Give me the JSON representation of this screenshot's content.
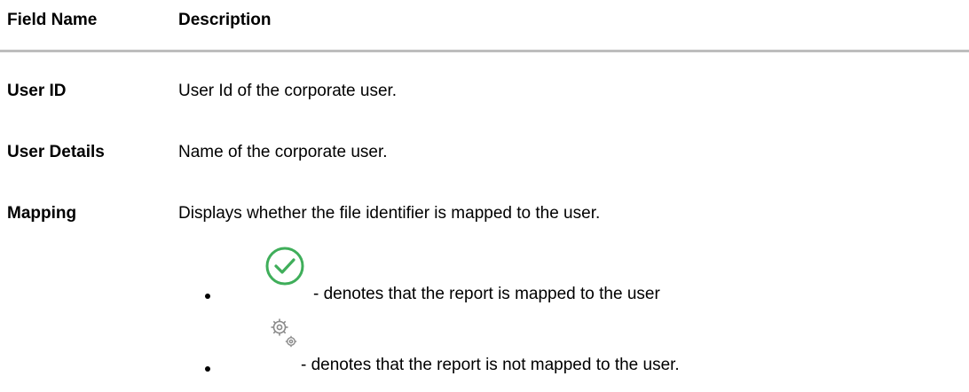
{
  "table": {
    "headers": {
      "field_name": "Field Name",
      "description": "Description"
    },
    "rows": [
      {
        "field": "User ID",
        "description": "User Id of the corporate user."
      },
      {
        "field": "User Details",
        "description": "Name of the corporate user."
      },
      {
        "field": "Mapping",
        "description": "Displays whether the file identifier is mapped to the user."
      }
    ],
    "mapping_bullets": [
      {
        "icon": "check-circle-icon",
        "text": "- denotes that the report is mapped to the user"
      },
      {
        "icon": "gears-icon",
        "text": "- denotes that the report is not mapped to the user."
      }
    ]
  },
  "colors": {
    "header_rule": "#bdbdbd",
    "check_green": "#3fae5a",
    "gear_gray": "#8a8a8a"
  }
}
